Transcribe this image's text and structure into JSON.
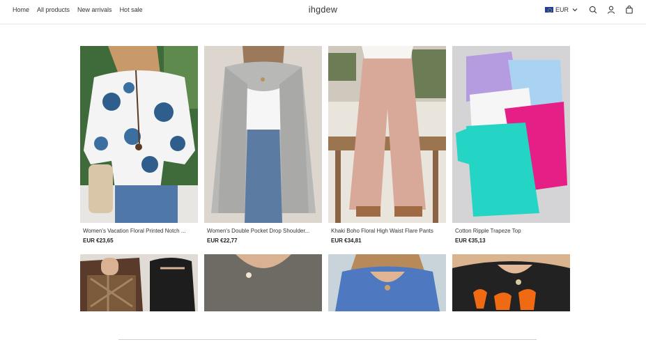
{
  "header": {
    "nav": [
      "Home",
      "All products",
      "New arrivals",
      "Hot sale"
    ],
    "logo": "ihgdew",
    "currency": "EUR",
    "icons": [
      "flag-icon",
      "chevron-down-icon",
      "search-icon",
      "account-icon",
      "cart-icon"
    ]
  },
  "products": [
    {
      "title": "Women's Vacation Floral Printed Notch ...",
      "price": "EUR €23,65"
    },
    {
      "title": "Women's Double Pocket Drop Shoulder...",
      "price": "EUR €22,77"
    },
    {
      "title": "Khaki Boho Floral High Waist Flare Pants",
      "price": "EUR €34,81"
    },
    {
      "title": "Cotton Ripple Trapeze Top",
      "price": "EUR €35,13"
    }
  ]
}
